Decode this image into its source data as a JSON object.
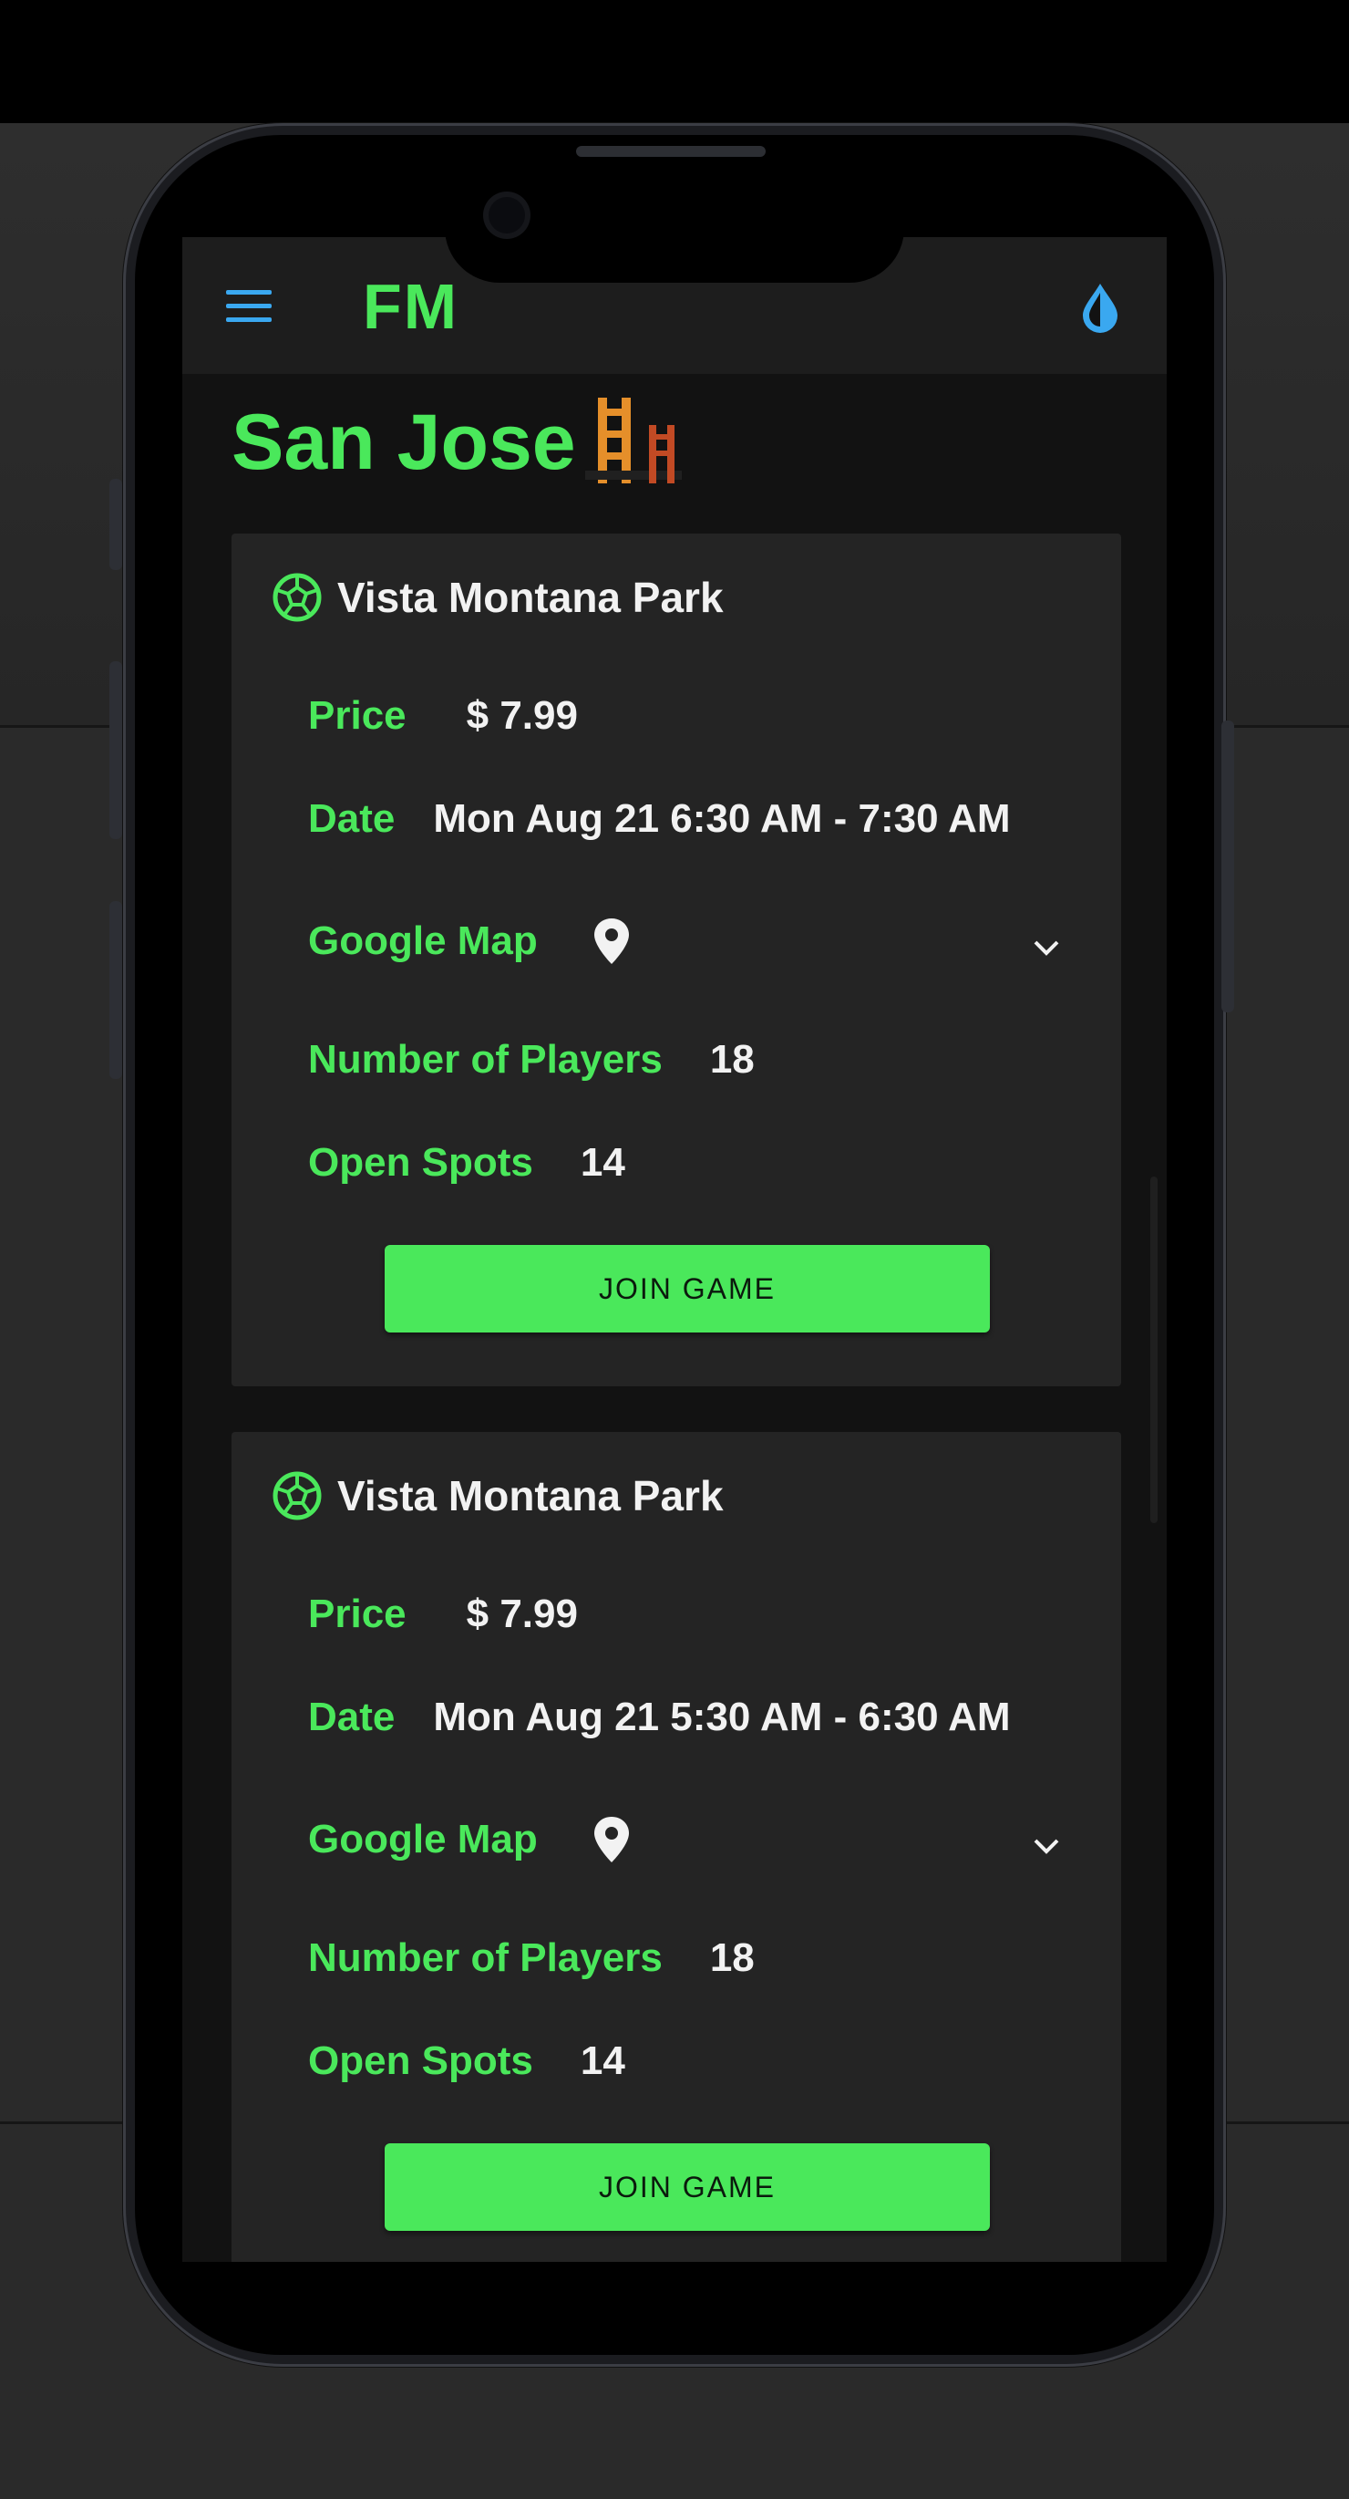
{
  "appbar": {
    "brand": "FM",
    "menu_icon": "menu-icon",
    "theme_icon": "water-drop-icon",
    "accent": "#3aa8f0"
  },
  "page": {
    "city": "San Jose",
    "city_icon": "bridge-icon",
    "accent": "#4ae85b"
  },
  "games": [
    {
      "title": "Vista Montana Park",
      "price_label": "Price",
      "price": "$ 7.99",
      "date_label": "Date",
      "date": "Mon Aug 21 6:30 AM - 7:30 AM",
      "map_label": "Google Map",
      "players_label": "Number of Players",
      "players": "18",
      "spots_label": "Open Spots",
      "spots": "14",
      "join_label": "JOIN GAME"
    },
    {
      "title": "Vista Montana Park",
      "price_label": "Price",
      "price": "$ 7.99",
      "date_label": "Date",
      "date": "Mon Aug 21 5:30 AM - 6:30 AM",
      "map_label": "Google Map",
      "players_label": "Number of Players",
      "players": "18",
      "spots_label": "Open Spots",
      "spots": "14",
      "join_label": "JOIN GAME"
    }
  ]
}
